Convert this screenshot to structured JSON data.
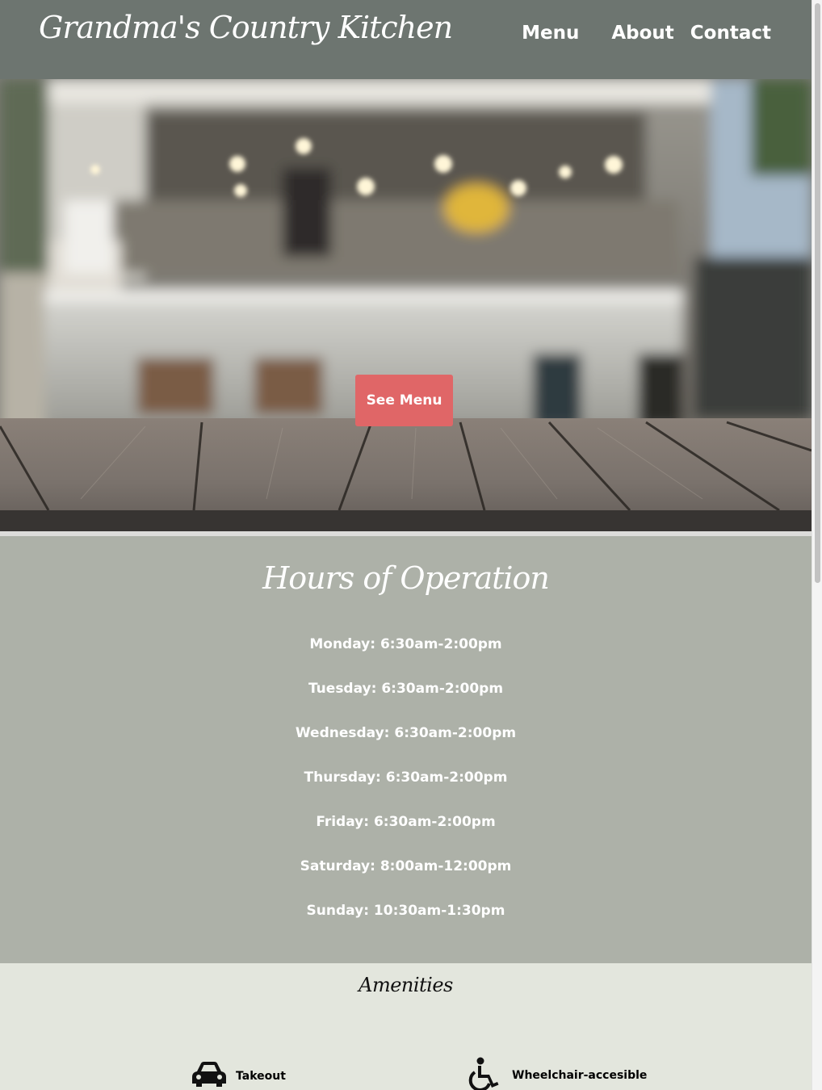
{
  "header": {
    "brand": "Grandma's Country Kitchen",
    "nav": [
      "Menu",
      "About",
      "Contact"
    ]
  },
  "hero": {
    "button_label": "See Menu"
  },
  "hours": {
    "title": "Hours of Operation",
    "days": [
      "Monday: 6:30am-2:00pm",
      "Tuesday: 6:30am-2:00pm",
      "Wednesday: 6:30am-2:00pm",
      "Thursday: 6:30am-2:00pm",
      "Friday: 6:30am-2:00pm",
      "Saturday: 8:00am-12:00pm",
      "Sunday: 10:30am-1:30pm"
    ]
  },
  "amenities": {
    "title": "Amenities",
    "items": [
      {
        "label": "Takeout",
        "icon": "car-icon"
      },
      {
        "label": "Wheelchair-accesible",
        "icon": "wheelchair-icon"
      }
    ]
  },
  "colors": {
    "header_bg": "#6d7570",
    "button": "#e06667",
    "hours_bg": "#adb1a8",
    "amenities_bg": "#e3e6dd"
  }
}
